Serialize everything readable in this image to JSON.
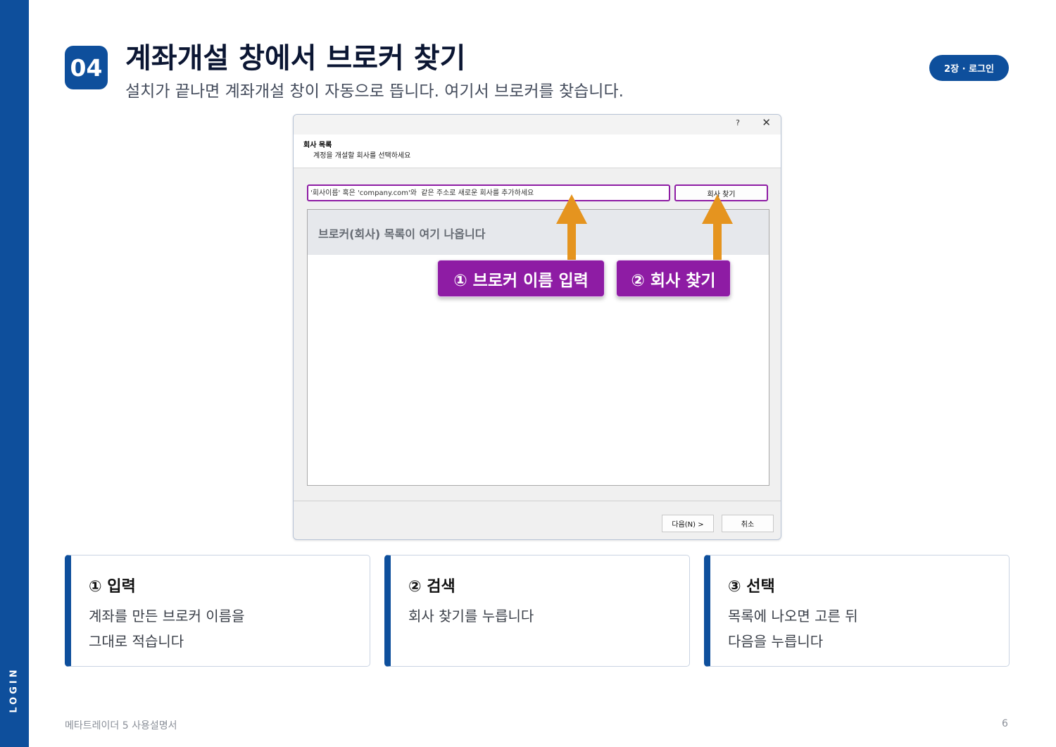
{
  "sidebar": {
    "label": "LOGIN"
  },
  "header": {
    "step_number": "04",
    "title": "계좌개설 창에서 브로커 찾기",
    "subtitle": "설치가 끝나면 계좌개설 창이 자동으로 뜹니다. 여기서 브로커를 찾습니다.",
    "chapter": "2장 · 로그인"
  },
  "dialog": {
    "help_label": "?",
    "close_label": "✕",
    "section_title": "회사 목록",
    "section_desc": "계정을 개설할 회사를 선택하세요",
    "search_placeholder": "'회사이름' 혹은 'company.com'와  같은 주소로 새로운 회사를 추가하세요",
    "find_button": "회사 찾기",
    "list_placeholder": "브로커(회사) 목록이 여기 나옵니다",
    "next_button": "다음(N) >",
    "cancel_button": "취소"
  },
  "annotations": [
    {
      "label": "① 브로커 이름 입력"
    },
    {
      "label": "② 회사 찾기"
    }
  ],
  "colors": {
    "brand_blue": "#0e4f9c",
    "highlight_purple": "#8e1ca4",
    "arrow_orange": "#e5941f"
  },
  "cards": [
    {
      "title": "① 입력",
      "line1": "계좌를 만든 브로커 이름을",
      "line2": "그대로 적습니다"
    },
    {
      "title": "② 검색",
      "line1": "회사 찾기를 누릅니다",
      "line2": ""
    },
    {
      "title": "③ 선택",
      "line1": "목록에 나오면 고른 뒤",
      "line2": "다음을 누릅니다"
    }
  ],
  "footer": {
    "doc_title": "메타트레이더 5 사용설명서",
    "page_number": "6"
  }
}
